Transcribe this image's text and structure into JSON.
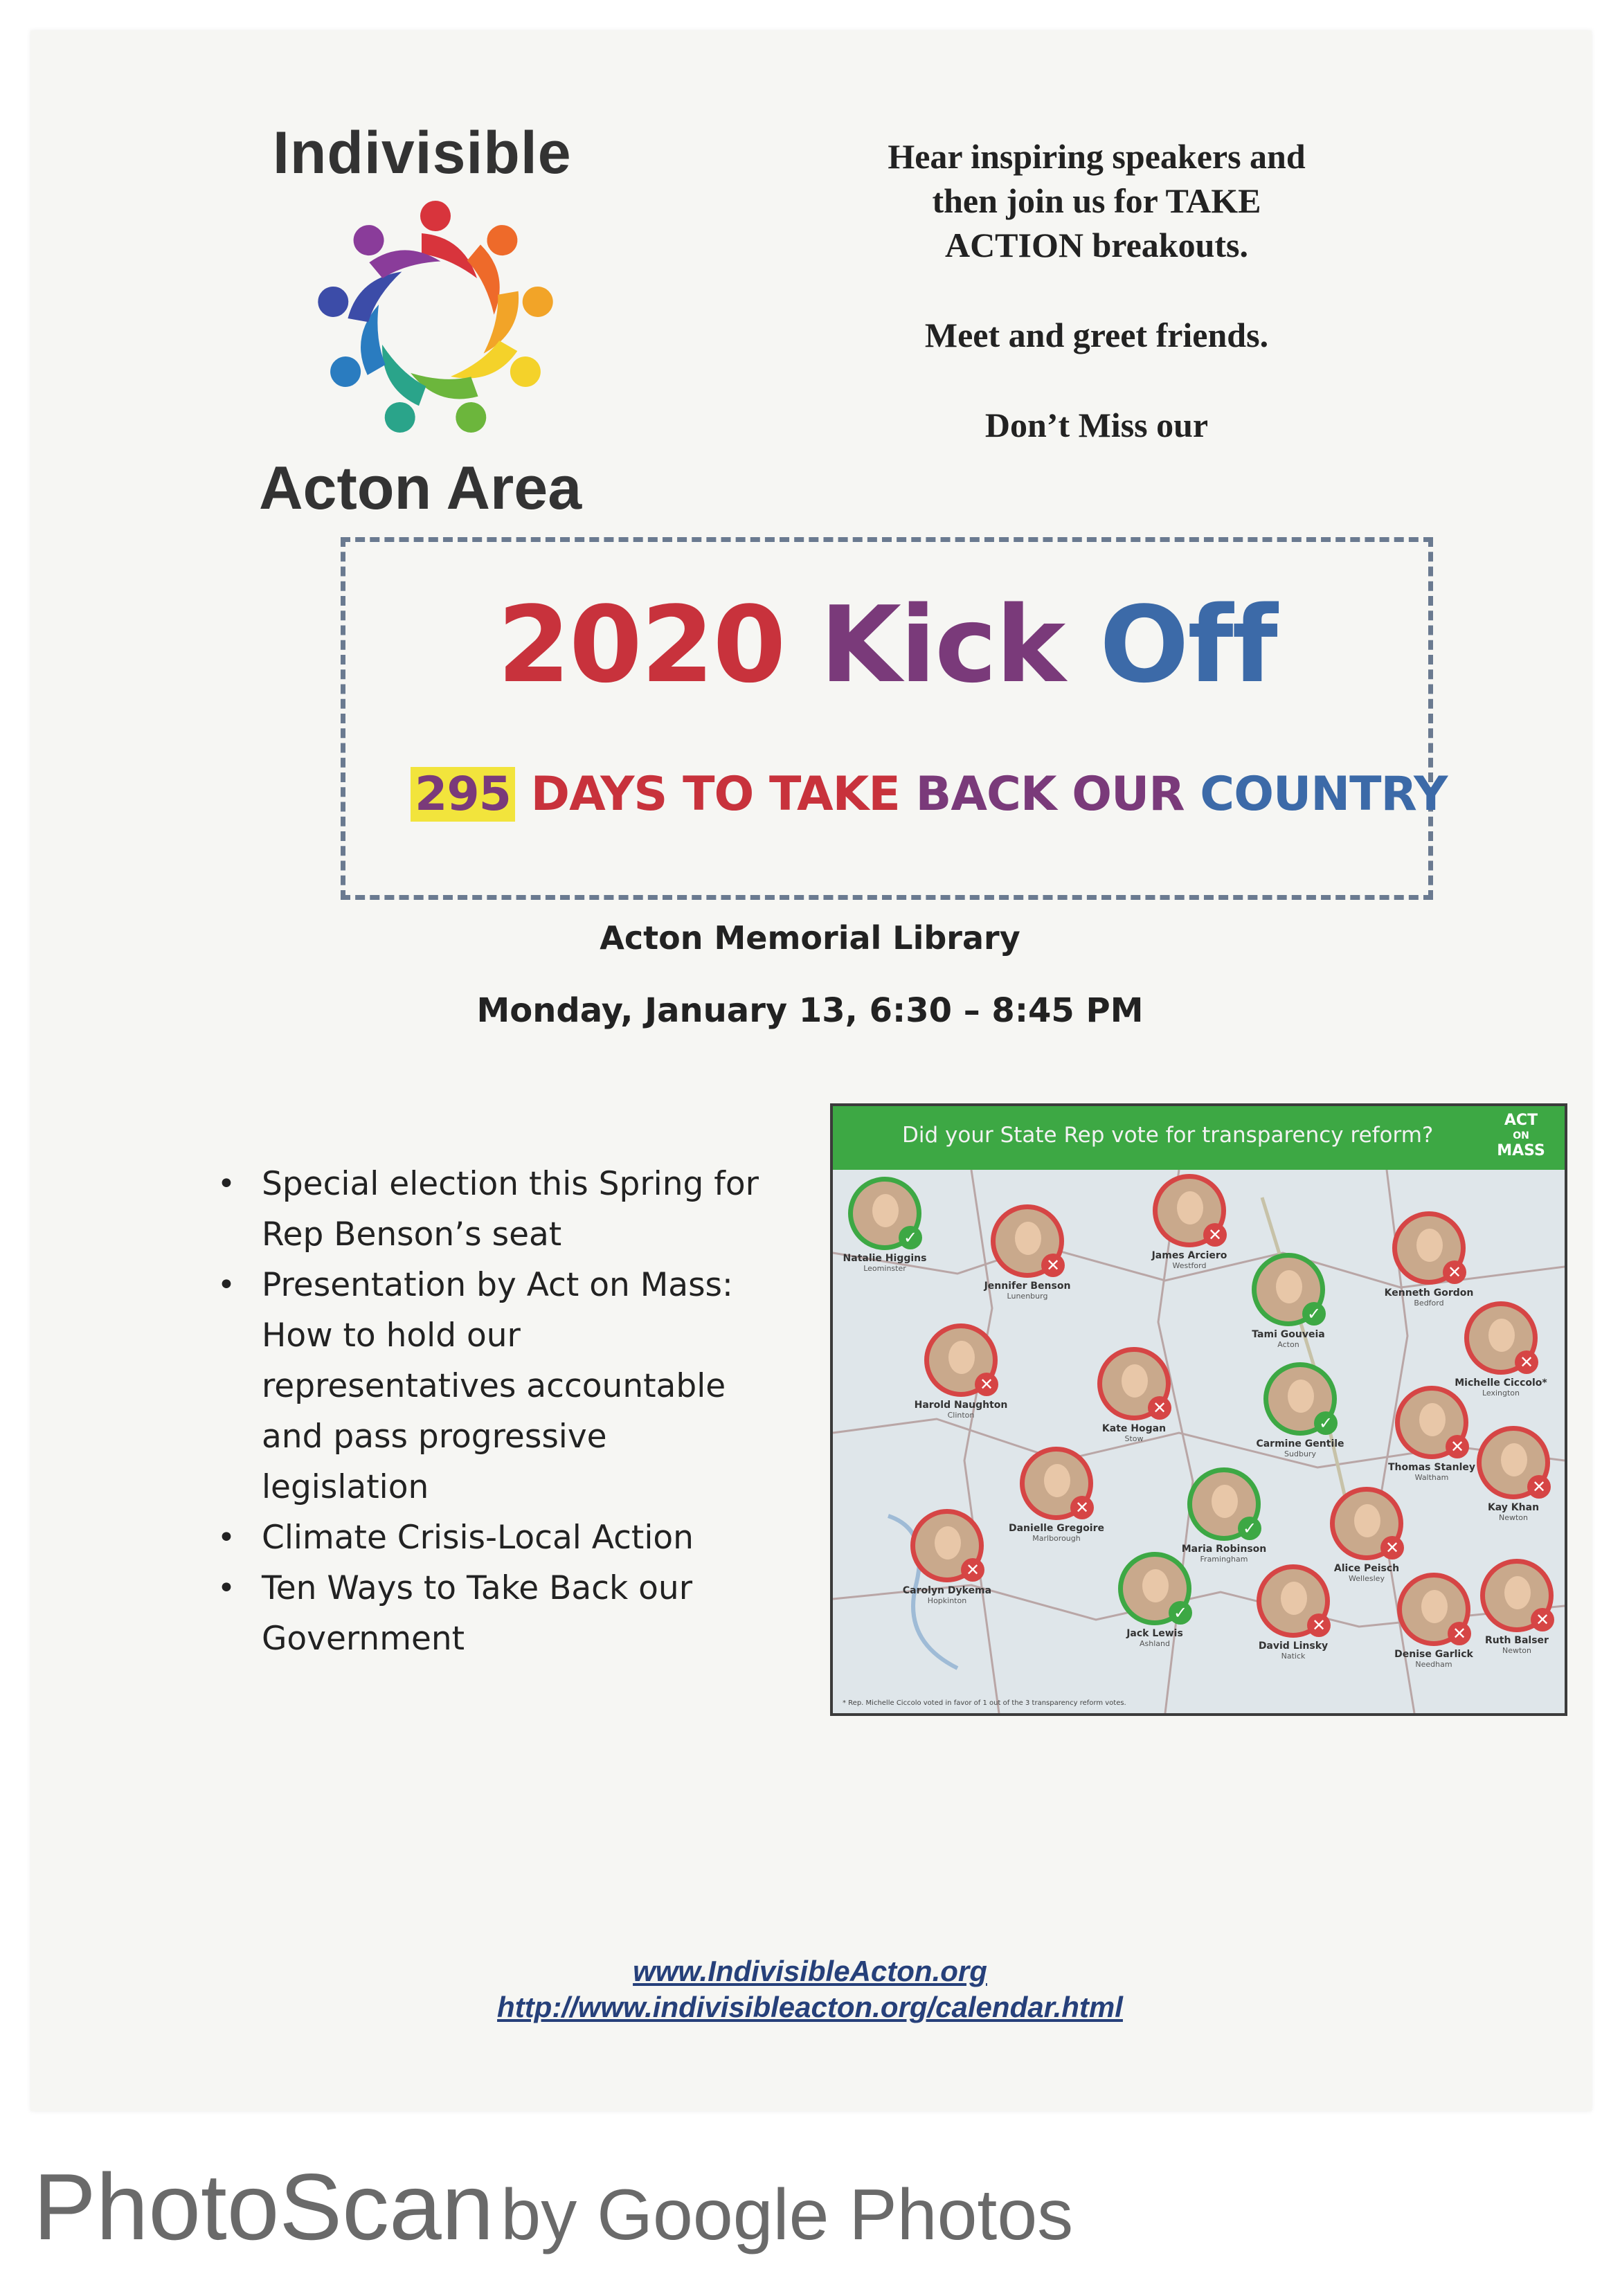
{
  "logo": {
    "top_text": "Indivisible",
    "bottom_text": "Acton Area",
    "icon": "rainbow-people-circle-icon"
  },
  "intro": {
    "lines": [
      "Hear inspiring speakers and",
      "then join us for TAKE",
      "ACTION breakouts."
    ],
    "meet": "Meet and greet friends.",
    "dont_miss": "Don’t Miss our"
  },
  "kickoff": {
    "title_part1": "2020 ",
    "title_part2": "Kick ",
    "title_part3": "Off",
    "days_number": "295",
    "days_text_a": " DAYS TO TAKE ",
    "days_text_b": "BACK OUR ",
    "days_text_c": "COUNTRY"
  },
  "event": {
    "venue": "Acton Memorial Library",
    "datetime": "Monday, January 13, 6:30 – 8:45 PM"
  },
  "agenda": [
    "Special election this Spring for",
    "Rep Benson’s seat",
    "Presentation by Act on Mass:",
    "How to hold our",
    "representatives accountable",
    "and pass progressive",
    "legislation",
    "Climate Crisis-Local Action",
    "Ten Ways to Take Back our",
    "Government"
  ],
  "bullet_glyph": "•",
  "map": {
    "header": "Did your State Rep vote for transparency reform?",
    "logo_line1": "ACT",
    "logo_line2": "ON",
    "logo_line3": "MASS",
    "footnote": "* Rep. Michelle Ciccolo voted in favor of 1 out of the 3 transparency reform votes.",
    "colors": {
      "yes": "#3da844",
      "no": "#d64545",
      "header": "#3da844"
    },
    "reps": [
      {
        "name": "Natalie Higgins",
        "town": "Leominster",
        "vote": "yes",
        "mark": "✓"
      },
      {
        "name": "Jennifer Benson",
        "town": "Lunenburg",
        "vote": "no",
        "mark": "✕"
      },
      {
        "name": "James Arciero",
        "town": "Westford",
        "vote": "no",
        "mark": "✕"
      },
      {
        "name": "Tami Gouveia",
        "town": "Acton",
        "vote": "yes",
        "mark": "✓"
      },
      {
        "name": "Kenneth Gordon",
        "town": "Bedford",
        "vote": "no",
        "mark": "✕"
      },
      {
        "name": "Michelle Ciccolo*",
        "town": "Lexington",
        "vote": "no",
        "mark": "✕"
      },
      {
        "name": "Harold Naughton",
        "town": "Clinton",
        "vote": "no",
        "mark": "✕"
      },
      {
        "name": "Kate Hogan",
        "town": "Stow",
        "vote": "no",
        "mark": "✕"
      },
      {
        "name": "Carmine Gentile",
        "town": "Sudbury",
        "vote": "yes",
        "mark": "✓"
      },
      {
        "name": "Thomas Stanley",
        "town": "Waltham",
        "vote": "no",
        "mark": "✕"
      },
      {
        "name": "Kay Khan",
        "town": "Newton",
        "vote": "no",
        "mark": "✕"
      },
      {
        "name": "Danielle Gregoire",
        "town": "Marlborough",
        "vote": "no",
        "mark": "✕"
      },
      {
        "name": "Maria Robinson",
        "town": "Framingham",
        "vote": "yes",
        "mark": "✓"
      },
      {
        "name": "Alice Peisch",
        "town": "Wellesley",
        "vote": "no",
        "mark": "✕"
      },
      {
        "name": "Carolyn Dykema",
        "town": "Hopkinton",
        "vote": "no",
        "mark": "✕"
      },
      {
        "name": "Jack Lewis",
        "town": "Ashland",
        "vote": "yes",
        "mark": "✓"
      },
      {
        "name": "David Linsky",
        "town": "Natick",
        "vote": "no",
        "mark": "✕"
      },
      {
        "name": "Denise Garlick",
        "town": "Needham",
        "vote": "no",
        "mark": "✕"
      },
      {
        "name": "Ruth Balser",
        "town": "Newton",
        "vote": "no",
        "mark": "✕"
      }
    ]
  },
  "links": {
    "website": "www.IndivisibleActon.org",
    "calendar": "http://www.indivisibleacton.org/calendar.html"
  },
  "branding": {
    "product": "PhotoScan",
    "by": "by Google Photos"
  }
}
